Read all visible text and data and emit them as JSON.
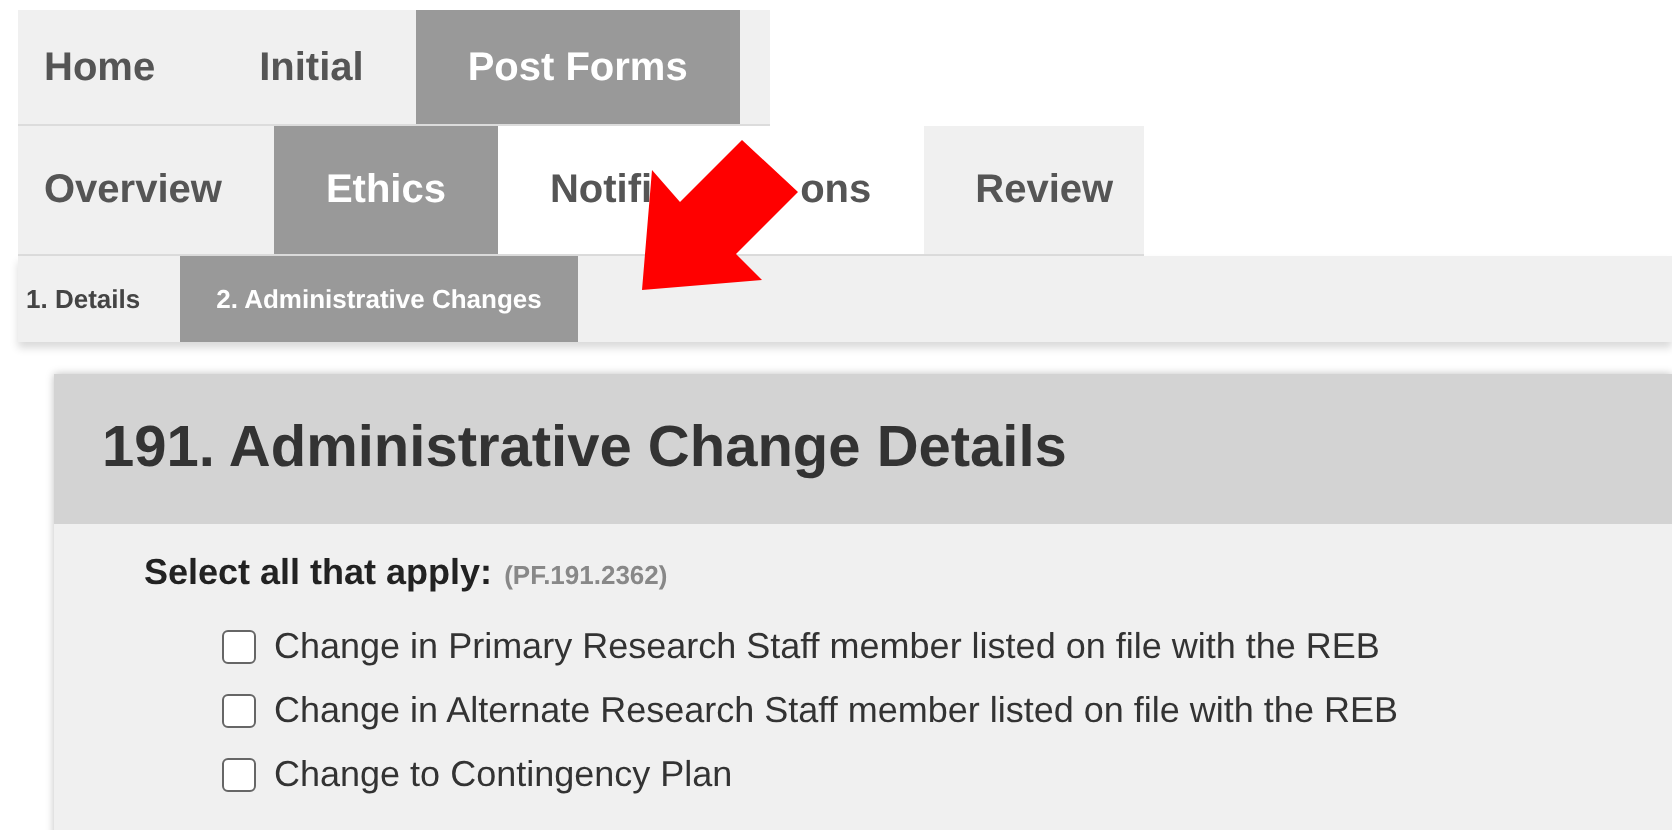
{
  "main_tabs": [
    {
      "label": "Home",
      "selected": false
    },
    {
      "label": "Initial",
      "selected": false
    },
    {
      "label": "Post Forms",
      "selected": true
    }
  ],
  "sub_tabs": [
    {
      "label": "Overview",
      "selected": false
    },
    {
      "label": "Ethics",
      "selected": true
    },
    {
      "label": "Notifi",
      "label_tail": "ons",
      "selected": false
    },
    {
      "label": "Review",
      "selected": false
    }
  ],
  "steps": [
    {
      "label": "1. Details",
      "selected": false
    },
    {
      "label": "2. Administrative Changes",
      "selected": true
    }
  ],
  "section": {
    "title": "191. Administrative Change Details",
    "prompt": "Select all that apply:",
    "code": "(PF.191.2362)",
    "options": [
      {
        "label": "Change in Primary Research Staff member listed on file with the REB",
        "checked": false
      },
      {
        "label": "Change in Alternate Research Staff member listed on file with the REB",
        "checked": false
      },
      {
        "label": "Change to Contingency Plan",
        "checked": false
      }
    ]
  }
}
